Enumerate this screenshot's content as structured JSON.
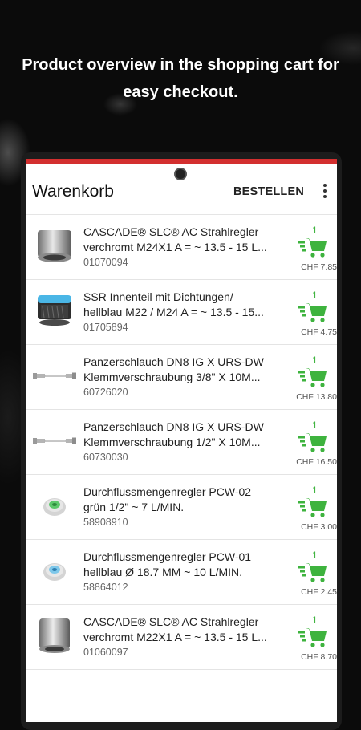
{
  "promo": {
    "headline_line1": "Product overview in the shopping cart for",
    "headline_line2": "easy checkout."
  },
  "colors": {
    "accent": "#d32f2f",
    "cart_green": "#3eb33e"
  },
  "appbar": {
    "title": "Warenkorb",
    "order_label": "BESTELLEN",
    "menu_icon": "more-vert-icon"
  },
  "cart_items": [
    {
      "line1": "CASCADE® SLC® AC Strahlregler",
      "line2": "verchromt M24X1 A = ~ 13.5 - 15 L...",
      "sku": "01070094",
      "qty": "1",
      "price": "CHF 7.85",
      "thumb": "aerator-chrome-icon"
    },
    {
      "line1": "SSR Innenteil mit Dichtungen/",
      "line2": "hellblau M22 / M24 A = ~ 13.5 - 15...",
      "sku": "01705894",
      "qty": "1",
      "price": "CHF 4.75",
      "thumb": "aerator-insert-blue-icon"
    },
    {
      "line1": "Panzerschlauch DN8 IG X URS-DW",
      "line2": "Klemmverschraubung 3/8\" X 10M...",
      "sku": "60726020",
      "qty": "1",
      "price": "CHF 13.80",
      "thumb": "hose-icon"
    },
    {
      "line1": "Panzerschlauch DN8 IG X URS-DW",
      "line2": "Klemmverschraubung 1/2\" X 10M...",
      "sku": "60730030",
      "qty": "1",
      "price": "CHF 16.50",
      "thumb": "hose-icon"
    },
    {
      "line1": "Durchflussmengenregler PCW-02",
      "line2": "grün 1/2\" ~ 7 L/MIN.",
      "sku": "58908910",
      "qty": "1",
      "price": "CHF 3.00",
      "thumb": "flow-regulator-green-icon"
    },
    {
      "line1": "Durchflussmengenregler PCW-01",
      "line2": "hellblau Ø 18.7 MM ~ 10 L/MIN.",
      "sku": "58864012",
      "qty": "1",
      "price": "CHF 2.45",
      "thumb": "flow-regulator-blue-icon"
    },
    {
      "line1": "CASCADE® SLC® AC Strahlregler",
      "line2": "verchromt M22X1 A = ~ 13.5 - 15 L...",
      "sku": "01060097",
      "qty": "1",
      "price": "CHF 8.70",
      "thumb": "aerator-chrome-icon"
    }
  ]
}
